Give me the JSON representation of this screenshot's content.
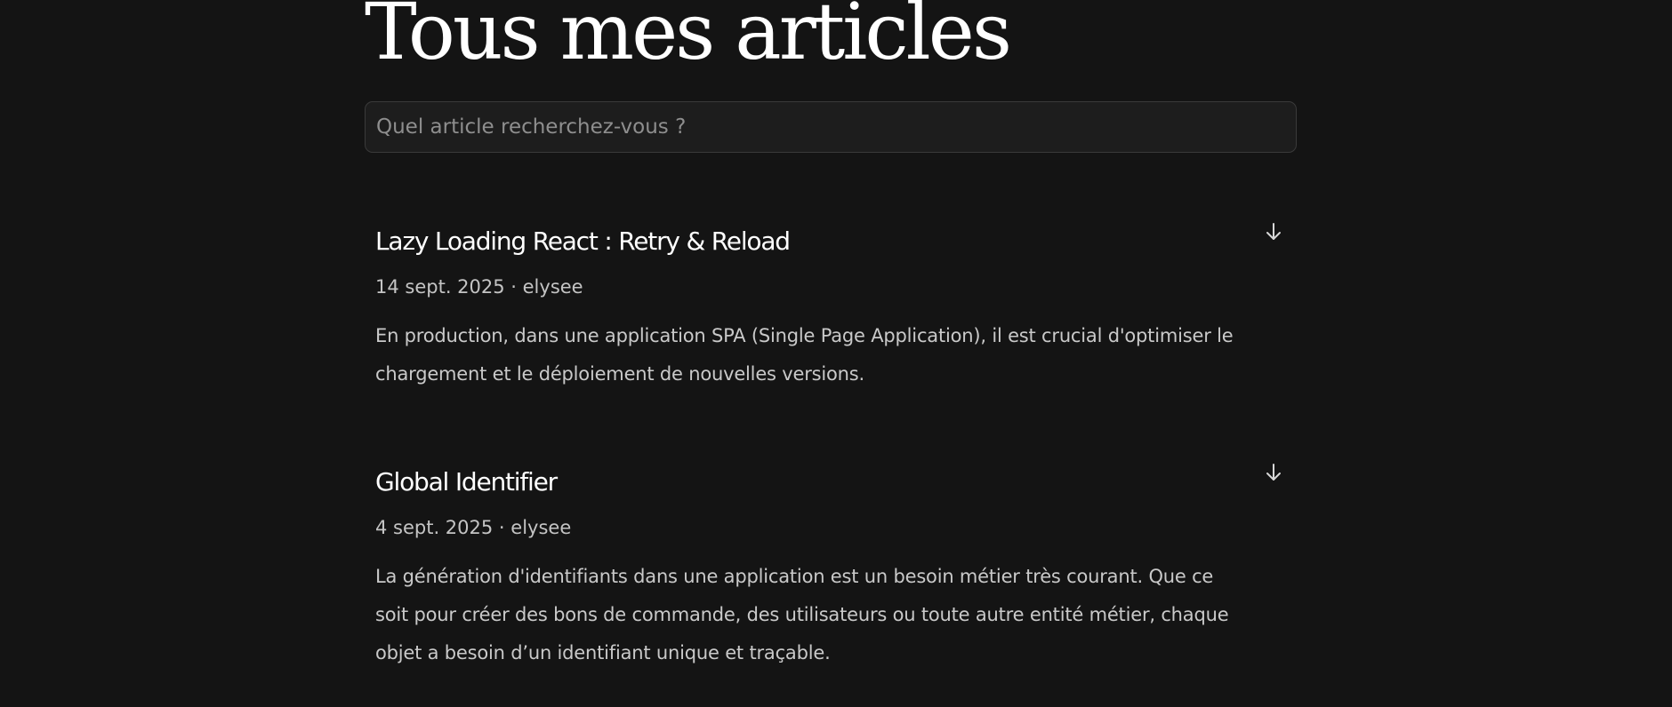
{
  "page": {
    "title": "Tous mes articles"
  },
  "search": {
    "placeholder": "Quel article recherchez-vous ?",
    "value": ""
  },
  "articles": [
    {
      "title": "Lazy Loading React : Retry & Reload",
      "meta": "14 sept. 2025 · elysee",
      "excerpt": "En production, dans une application SPA (Single Page Application), il est crucial d'optimiser le chargement et le déploiement de nouvelles versions.",
      "toggle_icon": "arrow-down-icon"
    },
    {
      "title": "Global Identifier",
      "meta": "4 sept. 2025 · elysee",
      "excerpt": "La génération d'identifiants dans une application est un besoin métier très courant. Que ce soit pour créer des bons de commande, des utilisateurs ou toute autre entité métier, chaque objet a besoin d’un identifiant unique et traçable.",
      "toggle_icon": "arrow-down-icon"
    }
  ],
  "colors": {
    "background": "#141414",
    "title": "#ffffff",
    "text": "#c9c9c9",
    "input_border": "#3a3a3a",
    "input_bg": "#1d1d1d"
  }
}
